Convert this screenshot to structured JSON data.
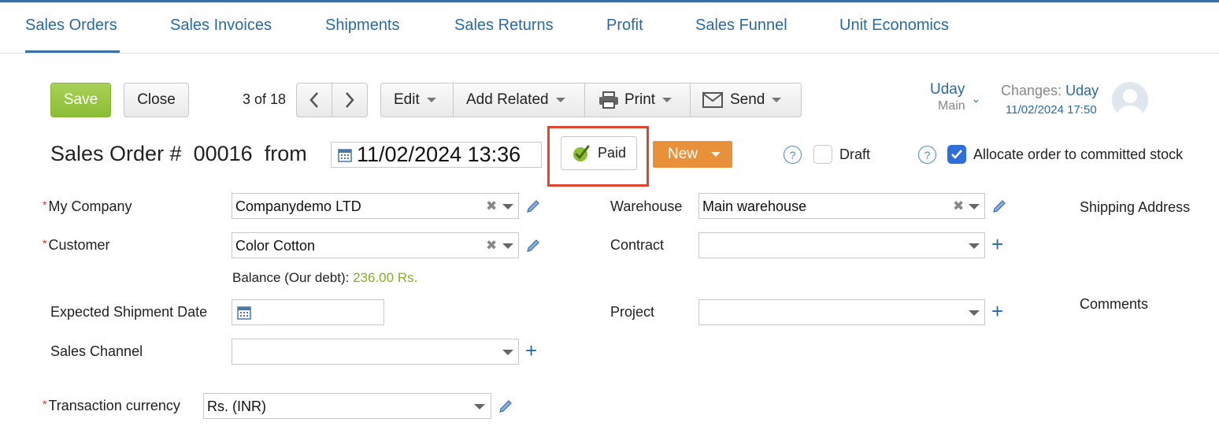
{
  "tabs": [
    "Sales Orders",
    "Sales Invoices",
    "Shipments",
    "Sales Returns",
    "Profit",
    "Sales Funnel",
    "Unit Economics"
  ],
  "toolbar": {
    "save": "Save",
    "close": "Close",
    "pager": "3 of 18",
    "edit": "Edit",
    "add_related": "Add Related",
    "print": "Print",
    "send": "Send"
  },
  "user": {
    "name": "Uday",
    "sub": "Main",
    "changes_label": "Changes:",
    "changes_user": "Uday",
    "changes_date": "11/02/2024 17:50"
  },
  "header": {
    "title": "Sales Order #",
    "number": "00016",
    "from": "from",
    "datetime": "11/02/2024 13:36",
    "paid": "Paid",
    "status": "New",
    "draft": "Draft",
    "allocate": "Allocate order to committed stock",
    "help": "?"
  },
  "form": {
    "my_company_label": "My Company",
    "my_company_value": "Companydemo LTD",
    "customer_label": "Customer",
    "customer_value": "Color Cotton",
    "balance_label": "Balance (Our debt):",
    "balance_value": "236.00 Rs.",
    "expected_shipment_label": "Expected Shipment Date",
    "sales_channel_label": "Sales Channel",
    "transaction_currency_label": "Transaction currency",
    "transaction_currency_value": "Rs. (INR)",
    "warehouse_label": "Warehouse",
    "warehouse_value": "Main warehouse",
    "contract_label": "Contract",
    "project_label": "Project",
    "shipping_address_label": "Shipping Address",
    "comments_label": "Comments",
    "required_mark": "*"
  },
  "colors": {
    "accent": "#2a6aa3",
    "save_green": "#8bbd34",
    "status_orange": "#e8913a",
    "highlight_red": "#e0462d",
    "balance_green": "#84b02a"
  }
}
